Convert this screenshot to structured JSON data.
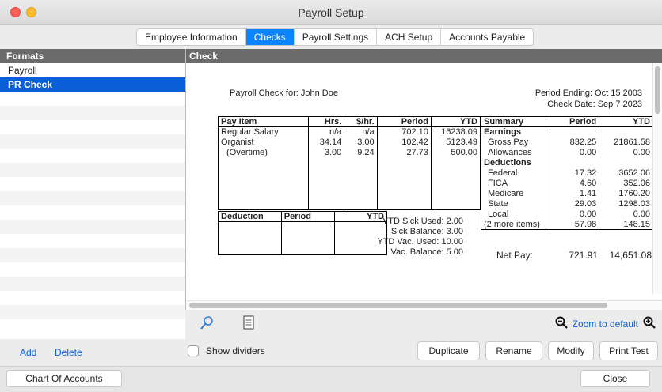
{
  "window": {
    "title": "Payroll Setup"
  },
  "tabs": [
    {
      "label": "Employee Information"
    },
    {
      "label": "Checks"
    },
    {
      "label": "Payroll Settings"
    },
    {
      "label": "ACH Setup"
    },
    {
      "label": "Accounts Payable"
    }
  ],
  "formats": {
    "header": "Formats",
    "items": [
      {
        "label": "Payroll"
      },
      {
        "label": "PR Check"
      }
    ]
  },
  "check": {
    "header": "Check",
    "payroll_for": "Payroll Check for:  John Doe",
    "period_ending": "Period Ending:  Oct 15 2003",
    "check_date": "Check Date: Sep 7 2023",
    "pay_table": {
      "headers": [
        "Pay Item",
        "Hrs.",
        "$/hr.",
        "Period",
        "YTD"
      ],
      "rows": [
        [
          "Regular Salary",
          "n/a",
          "n/a",
          "702.10",
          "16238.09"
        ],
        [
          "Organist",
          "34.14",
          "3.00",
          "102.42",
          "5123.49"
        ],
        [
          "  (Overtime)",
          "3.00",
          "9.24",
          "27.73",
          "500.00"
        ]
      ]
    },
    "deduction_table": {
      "headers": [
        "Deduction",
        "Period",
        "YTD"
      ]
    },
    "balances": {
      "sick_used": "YTD Sick Used: 2.00",
      "sick_balance": "Sick Balance: 3.00",
      "vac_used": "YTD Vac. Used: 10.00",
      "vac_balance": "Vac. Balance: 5.00"
    },
    "summary": {
      "headers": [
        "Summary",
        "Period",
        "YTD"
      ],
      "rows": [
        [
          "Earnings",
          "",
          ""
        ],
        [
          "  Gross Pay",
          "832.25",
          "21861.58"
        ],
        [
          "  Allowances",
          "0.00",
          "0.00"
        ],
        [
          "Deductions",
          "",
          ""
        ],
        [
          "  Federal",
          "17.32",
          "3652.06"
        ],
        [
          "  FICA",
          "4.60",
          "352.06"
        ],
        [
          "  Medicare",
          "1.41",
          "1760.20"
        ],
        [
          "  State",
          "29.03",
          "1298.03"
        ],
        [
          "  Local",
          "0.00",
          "0.00"
        ],
        [
          "(2 more items)",
          "57.98",
          "148.15"
        ]
      ],
      "net_pay_label": "Net Pay:",
      "net_pay_period": "721.91",
      "net_pay_ytd": "14,651.08"
    }
  },
  "zoom": {
    "label": "Zoom to default"
  },
  "actions": {
    "add": "Add",
    "delete": "Delete",
    "show_dividers": "Show dividers",
    "duplicate": "Duplicate",
    "rename": "Rename",
    "modify": "Modify",
    "print_test": "Print Test"
  },
  "footer": {
    "chart_of_accounts": "Chart Of Accounts",
    "close": "Close"
  },
  "colors": {
    "accent": "#0a84ff",
    "selection": "#0a5fd8",
    "header_gray": "#6b6b6b"
  }
}
